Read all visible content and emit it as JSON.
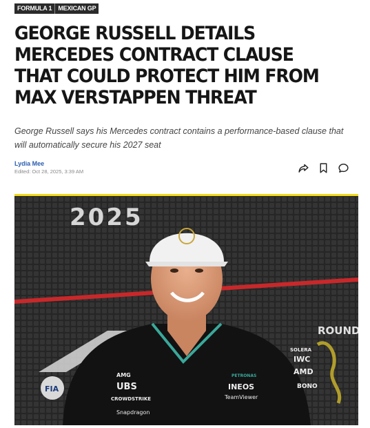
{
  "tags": [
    "FORMULA 1",
    "MEXICAN GP"
  ],
  "headline": "GEORGE RUSSELL DETAILS MERCEDES CONTRACT CLAUSE THAT COULD PROTECT HIM FROM MAX VERSTAPPEN THREAT",
  "standfirst": "George Russell says his Mercedes contract contains a performance-based clause that will automatically secure his 2027 seat",
  "byline": {
    "author": "Lydia Mee",
    "edited": "Edited: Oct 28, 2025, 3:39 AM"
  },
  "actions": [
    {
      "name": "share-icon"
    },
    {
      "name": "bookmark-icon"
    },
    {
      "name": "comment-icon"
    }
  ],
  "photo": {
    "backdrop_year": "2025",
    "round_text": "ROUND",
    "sponsors": [
      "AMG",
      "UBS",
      "CROWDSTRIKE",
      "Snapdragon",
      "PETRONAS",
      "INEOS",
      "TeamViewer",
      "SOLERA",
      "IWC",
      "AMD",
      "BONO"
    ],
    "fia_text": "FIA"
  },
  "colors": {
    "accent": "#f2d91a",
    "author_link": "#2a5db0",
    "tag_bg": "#2b2b2b"
  }
}
